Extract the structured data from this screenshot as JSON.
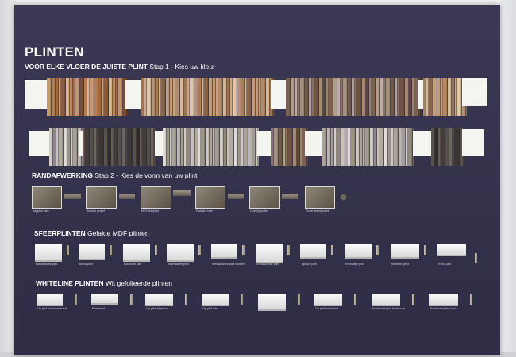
{
  "display": {
    "title": "PLINTEN",
    "step1": {
      "bold": "VOOR ELKE VLOER DE JUISTE PLINT",
      "rest": " Stap 1 - Kies uw kleur"
    },
    "randafwerking": {
      "bold": "RANDAFWERKING",
      "rest": " Stap 2 - Kies de vorm van uw plint",
      "captions": [
        "Bagplint fake",
        "Stalotte profiel",
        "MDF folieplint",
        "Rubplint folie",
        "Hoeklijnprofiel",
        "Rozet antislipnoest"
      ]
    },
    "sfeerplinten": {
      "bold": "SFEERPLINTEN",
      "rest": " Gelakte MDF plinten",
      "captions": [
        "Hollandsche plint",
        "Barok plint",
        "Koloniale plint",
        "Tegenkleine plint",
        "Renaissance plint modern",
        "Renaissance plint",
        "Tijdloze plint",
        "Renovatie plint",
        "Moderne plint",
        "Retro plint"
      ]
    },
    "whiteline": {
      "bold": "WHITELINE PLINTEN",
      "rest": " Wit gefolieerde plinten",
      "captions": [
        "Op plint bovenkantrand",
        "Plint recht",
        "Op plint afgerond",
        "Op plint kast",
        "Op plint hoflmond",
        "Op plint kwartrond",
        "Kwartrond plint kwartrond",
        "Kwartrond plint kast"
      ]
    }
  },
  "colors": {
    "board": "#34324b",
    "text": "#ffffff",
    "panel": "#f4f4f1"
  }
}
